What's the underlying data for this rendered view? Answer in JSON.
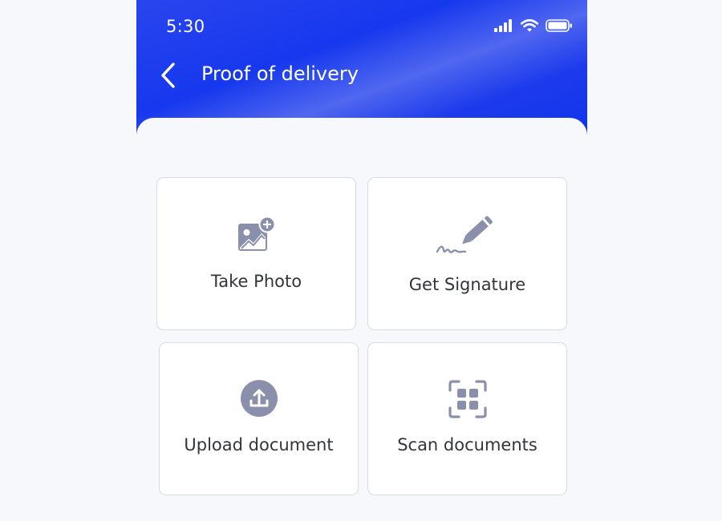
{
  "status_bar": {
    "time": "5:30",
    "icons": [
      "signal-icon",
      "wifi-icon",
      "battery-icon"
    ]
  },
  "header": {
    "back_icon": "chevron-left-icon",
    "title": "Proof of delivery"
  },
  "actions": [
    {
      "label": "Take Photo",
      "icon": "image-add-icon"
    },
    {
      "label": "Get Signature",
      "icon": "signature-pen-icon"
    },
    {
      "label": "Upload document",
      "icon": "upload-icon"
    },
    {
      "label": "Scan documents",
      "icon": "scan-icon"
    }
  ],
  "colors": {
    "header_blue": "#1638ee",
    "icon_gray": "#8a90ab",
    "card_border": "#d8dbe6",
    "background": "#f7f8fc"
  }
}
